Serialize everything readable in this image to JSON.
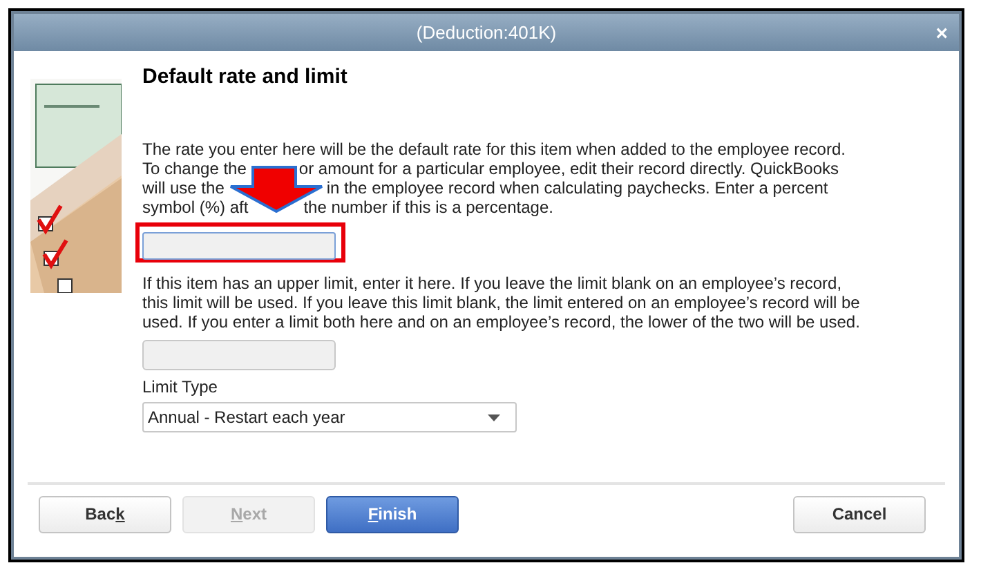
{
  "window": {
    "title": "(Deduction:401K)",
    "close": "×"
  },
  "heading": "Default rate and limit",
  "rate_text": [
    [
      "The rate you enter here will be the default rate for this item when added to the employee record."
    ],
    [
      "To change the",
      "or amount for a particular employee, edit their record directly.  QuickBooks"
    ],
    [
      "will use the",
      "in the employee record when calculating paychecks.  Enter a percent"
    ],
    [
      "symbol (%) aft",
      "the number if this is a percentage."
    ]
  ],
  "rate_field": {
    "highlighted": true
  },
  "limit_text": "If this item has an upper limit, enter it here. If you leave the limit blank on an employee’s record, this limit will be used.  If you leave this limit blank, the limit entered on an employee’s record will be used.  If you enter a limit both here and on an employee’s  record, the lower of the two will be used.",
  "limit_type": {
    "label": "Limit Type",
    "value": "Annual - Restart each year"
  },
  "buttons": [
    {
      "before": "Bac",
      "key": "k",
      "kind": "default",
      "disabled": false
    },
    {
      "key": "N",
      "after": "ext",
      "kind": "default",
      "disabled": true
    },
    {
      "key": "F",
      "after": "inish",
      "kind": "primary",
      "disabled": false
    },
    {
      "before": "Cancel",
      "kind": "default",
      "disabled": false
    }
  ]
}
